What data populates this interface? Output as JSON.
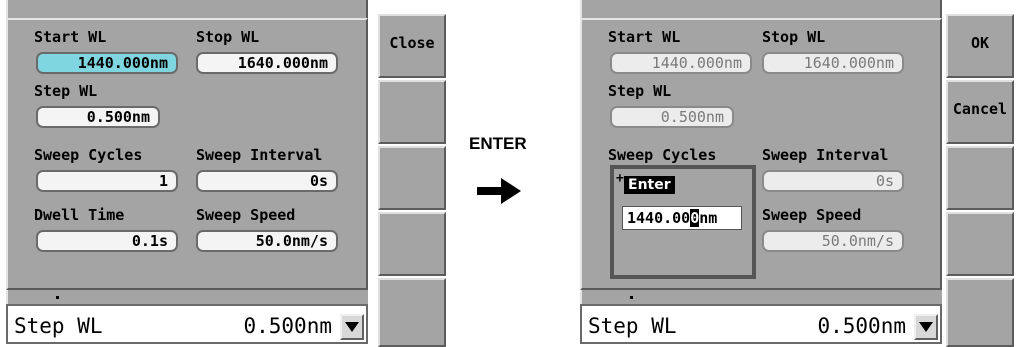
{
  "left": {
    "fields": {
      "start_wl": {
        "label": "Start WL",
        "value": "1440.000nm"
      },
      "stop_wl": {
        "label": "Stop WL",
        "value": "1640.000nm"
      },
      "step_wl": {
        "label": "Step WL",
        "value": "0.500nm"
      },
      "sweep_cycles": {
        "label": "Sweep Cycles",
        "value": "1"
      },
      "sweep_interval": {
        "label": "Sweep Interval",
        "value": "0s"
      },
      "dwell_time": {
        "label": "Dwell Time",
        "value": "0.1s"
      },
      "sweep_speed": {
        "label": "Sweep Speed",
        "value": "50.0nm/s"
      }
    },
    "softkeys": [
      "Close",
      "",
      "",
      "",
      ""
    ],
    "status": {
      "name": "Step WL",
      "value": "0.500nm"
    }
  },
  "transition": {
    "label": "ENTER"
  },
  "right": {
    "fields": {
      "start_wl": {
        "label": "Start WL",
        "value": "1440.000nm"
      },
      "stop_wl": {
        "label": "Stop WL",
        "value": "1640.000nm"
      },
      "step_wl": {
        "label": "Step WL",
        "value": "0.500nm"
      },
      "sweep_cycles": {
        "label": "Sweep Cycles"
      },
      "sweep_interval": {
        "label": "Sweep Interval",
        "value": "0s"
      },
      "sweep_speed": {
        "label": "Sweep Speed",
        "value": "50.0nm/s"
      }
    },
    "enter_popup": {
      "title": "Enter",
      "plus": "+",
      "value_before": "1440.00",
      "value_cursor": "0",
      "value_after": "nm"
    },
    "softkeys": [
      "OK",
      "Cancel",
      "",
      "",
      ""
    ],
    "status": {
      "name": "Step WL",
      "value": "0.500nm"
    }
  },
  "colors": {
    "selected_field": "#7fd6e0",
    "panel_gray": "#a4a4a4"
  }
}
